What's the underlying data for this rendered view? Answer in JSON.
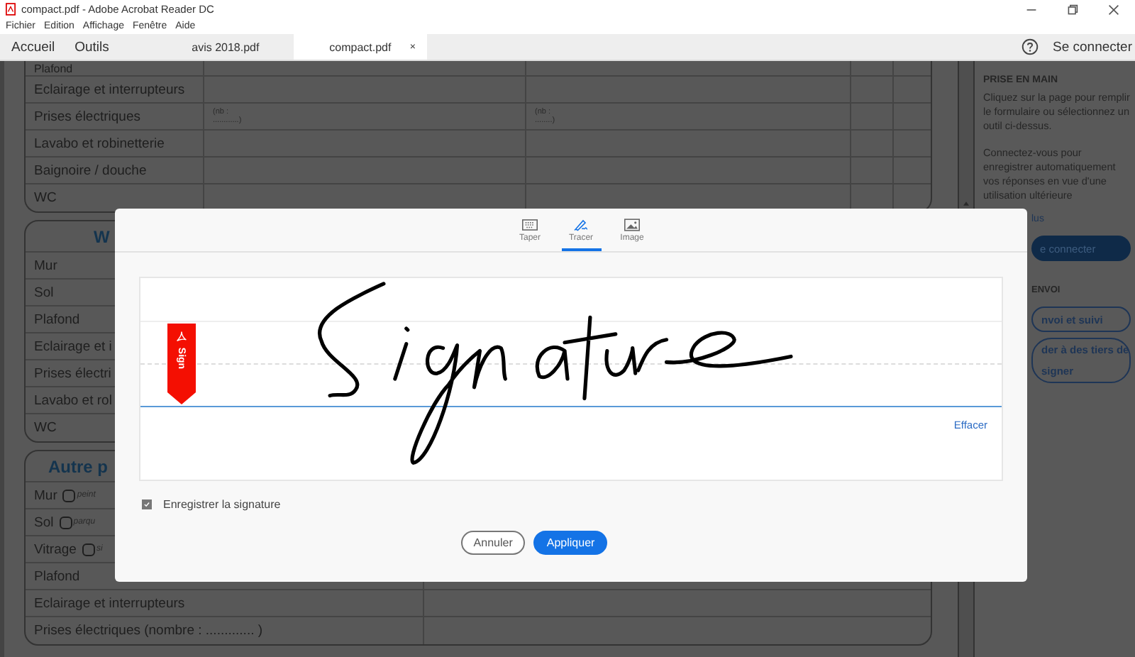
{
  "window": {
    "title": "compact.pdf - Adobe Acrobat Reader DC"
  },
  "menu": [
    "Fichier",
    "Edition",
    "Affichage",
    "Fenêtre",
    "Aide"
  ],
  "nav": [
    "Accueil",
    "Outils"
  ],
  "doc_tabs": [
    {
      "label": "avis 2018.pdf",
      "selected": false
    },
    {
      "label": "compact.pdf",
      "selected": true,
      "close": "×"
    }
  ],
  "sign_in": "Se connecter",
  "document": {
    "sections": [
      {
        "kind": "grid",
        "rows": [
          {
            "label": "Plafond"
          },
          {
            "label": "Eclairage et interrupteurs"
          },
          {
            "label": "Prises électriques",
            "cells": [
              "(nb :\n............)",
              "(nb :\n........)"
            ]
          },
          {
            "label": "Lavabo et robinetterie"
          },
          {
            "label": "Baignoire / douche"
          },
          {
            "label": "WC"
          }
        ]
      },
      {
        "kind": "stub",
        "title": "W",
        "rows": [
          {
            "label": "Mur"
          },
          {
            "label": "Sol"
          },
          {
            "label": "Plafond"
          },
          {
            "label": "Eclairage et i"
          },
          {
            "label": "Prises électri"
          },
          {
            "label": "Lavabo et rol"
          },
          {
            "label": "WC"
          }
        ]
      },
      {
        "kind": "wide",
        "title": "Autre p",
        "rows": [
          {
            "label": "Mur",
            "option": "peint",
            "checked": false
          },
          {
            "label": "Sol",
            "option": "parqu",
            "checked": false
          },
          {
            "label": "Vitrage",
            "option": "si",
            "checked": false
          },
          {
            "label": "Plafond"
          },
          {
            "label": "Eclairage et interrupteurs"
          },
          {
            "label": "Prises électriques (nombre : ............. )"
          }
        ]
      }
    ]
  },
  "right_pane": {
    "heading": "PRISE EN MAIN",
    "paragraphs": [
      "Cliquez sur la page pour remplir le formulaire ou sélectionnez un outil ci-dessus.",
      "Connectez-vous pour enregistrer automatiquement vos réponses en vue d'une utilisation ultérieure"
    ],
    "link": "lus",
    "sign_in_button": "e connecter",
    "section_heading": "ENVOI",
    "buttons": [
      "nvoi et suivi",
      "der à des tiers de signer"
    ]
  },
  "signature_dialog": {
    "tabs": [
      {
        "label": "Taper",
        "kind": "keyboard",
        "selected": false
      },
      {
        "label": "Tracer",
        "kind": "pen",
        "selected": true
      },
      {
        "label": "Image",
        "kind": "image",
        "selected": false
      }
    ],
    "badge": "Sign",
    "clear": "Effacer",
    "save_signature": {
      "label": "Enregistrer la signature",
      "checked": true
    },
    "buttons": [
      {
        "label": "Annuler",
        "kind": "secondary"
      },
      {
        "label": "Appliquer",
        "kind": "primary"
      }
    ]
  }
}
